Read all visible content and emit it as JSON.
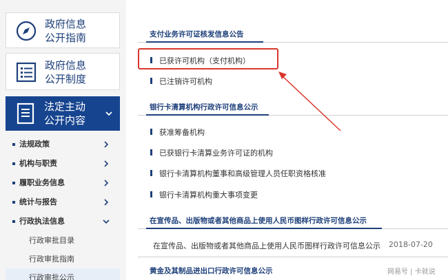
{
  "sidebar": {
    "box1": {
      "line1": "政府信息",
      "line2": "公开指南",
      "icon": "compass-icon"
    },
    "box2": {
      "line1": "政府信息",
      "line2": "公开制度",
      "icon": "list-document-icon"
    },
    "box3": {
      "line1": "法定主动",
      "line2": "公开内容",
      "icon": "document-icon"
    },
    "menu": [
      {
        "label": "法规政策"
      },
      {
        "label": "机构与职责"
      },
      {
        "label": "履职业务信息"
      },
      {
        "label": "统计与报告"
      },
      {
        "label": "行政执法信息"
      }
    ],
    "sub_items": [
      {
        "label": "行政审批目录"
      },
      {
        "label": "行政审批指南"
      },
      {
        "label": "行政审批公示"
      }
    ]
  },
  "main": {
    "sections": [
      {
        "title": "支付业务许可证核发信息公告",
        "links": [
          "已获许可机构（支付机构）",
          "已注销许可机构"
        ]
      },
      {
        "title": "银行卡清算机构行政许可信息公示",
        "links": [
          "获准筹备机构",
          "已获银行卡清算业务许可证的机构",
          "银行卡清算机构董事和高级管理人员任职资格核准",
          "银行卡清算机构重大事项变更"
        ]
      },
      {
        "title": "在宣传品、出版物或者其他商品上使用人民币图样行政许可信息公示",
        "row_text": "在宣传品、出版物或者其他商品上使用人民币图样行政许可信息公示",
        "row_date": "2018-07-20"
      },
      {
        "title": "黄金及其制品进出口行政许可信息公示"
      }
    ]
  },
  "watermark": "网易号 | 卡就说",
  "colors": {
    "brand_blue": "#16448f",
    "highlight_red": "#d9362b"
  }
}
